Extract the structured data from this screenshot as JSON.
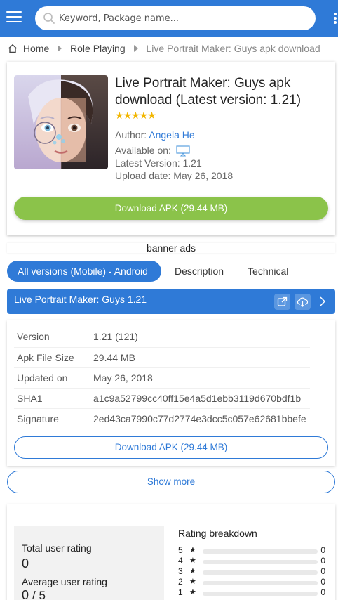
{
  "header": {
    "search_placeholder": "Keyword, Package name..."
  },
  "breadcrumb": {
    "home": "Home",
    "category": "Role Playing",
    "current": "Live Portrait Maker: Guys apk download"
  },
  "app": {
    "title": "Live Portrait Maker: Guys apk download (Latest version: 1.21)",
    "stars": "★★★★★",
    "author_label": "Author:",
    "author": "Angela He",
    "available_label": "Available on:",
    "available_icon": "monitor-icon",
    "latest_version": "Latest Version: 1.21",
    "upload_date": "Upload date: May 26, 2018",
    "download_label": "Download APK (29.44 MB)"
  },
  "banner": "banner ads",
  "tabs": [
    "All versions (Mobile) - Android",
    "Description",
    "Technical"
  ],
  "version_bar": {
    "title": "Live Portrait Maker: Guys 1.21",
    "icons": [
      "external-link-icon",
      "cloud-download-icon",
      "chevron-right-icon"
    ]
  },
  "specs": [
    {
      "key": "Version",
      "value": "1.21 (121)"
    },
    {
      "key": "Apk File Size",
      "value": "29.44 MB"
    },
    {
      "key": "Updated on",
      "value": "May 26, 2018"
    },
    {
      "key": "SHA1",
      "value": "a1c9a52799cc40ff15e4a5d1ebb3119d670bdf1b"
    },
    {
      "key": "Signature",
      "value": "2ed43ca7990c77d2774e3dcc5c057e62681bbefe"
    }
  ],
  "download_label_2": "Download APK (29.44 MB)",
  "show_more": "Show more",
  "ratings": {
    "total_label": "Total user rating",
    "total": "0",
    "average_label": "Average user rating",
    "average": "0",
    "average_suffix": "/ 5",
    "breakdown_title": "Rating breakdown",
    "star_glyph": "★",
    "rows": [
      {
        "stars": "5",
        "count": "0",
        "fraction": 0
      },
      {
        "stars": "4",
        "count": "0",
        "fraction": 0
      },
      {
        "stars": "3",
        "count": "0",
        "fraction": 0
      },
      {
        "stars": "2",
        "count": "0",
        "fraction": 0
      },
      {
        "stars": "1",
        "count": "0",
        "fraction": 0
      }
    ]
  },
  "colors": {
    "primary": "#2f7ad7",
    "download_green": "#8bc34a",
    "star": "#f2b600"
  }
}
